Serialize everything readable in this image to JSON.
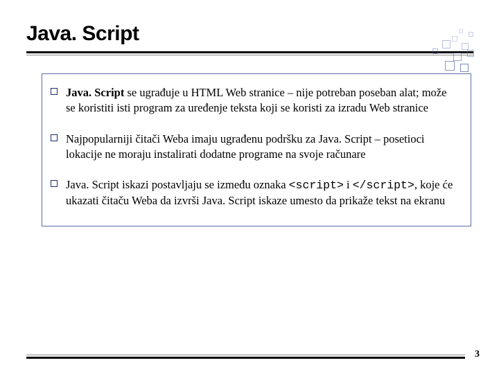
{
  "title": "Java. Script",
  "bullets": [
    {
      "lead_bold": "Java. Script",
      "rest": " se ugrađuje u HTML Web stranice – nije potreban poseban alat; može se koristiti isti program za uređenje teksta koji se koristi za izradu Web stranice"
    },
    {
      "full": "Najpopularniji čitači Weba imaju ugrađenu podršku za Java. Script – posetioci lokacije ne moraju instalirati dodatne programe na svoje računare"
    },
    {
      "pre": "Java. Script iskazi postavljaju se između oznaka ",
      "code1": "<script>",
      "mid": " i ",
      "code2": "</scr",
      "code2b": "ipt>",
      "post": ", koje će ukazati čitaču Weba da izvrši Java. Script iskaze umesto da prikaže tekst na ekranu"
    }
  ],
  "pageNumber": "3"
}
